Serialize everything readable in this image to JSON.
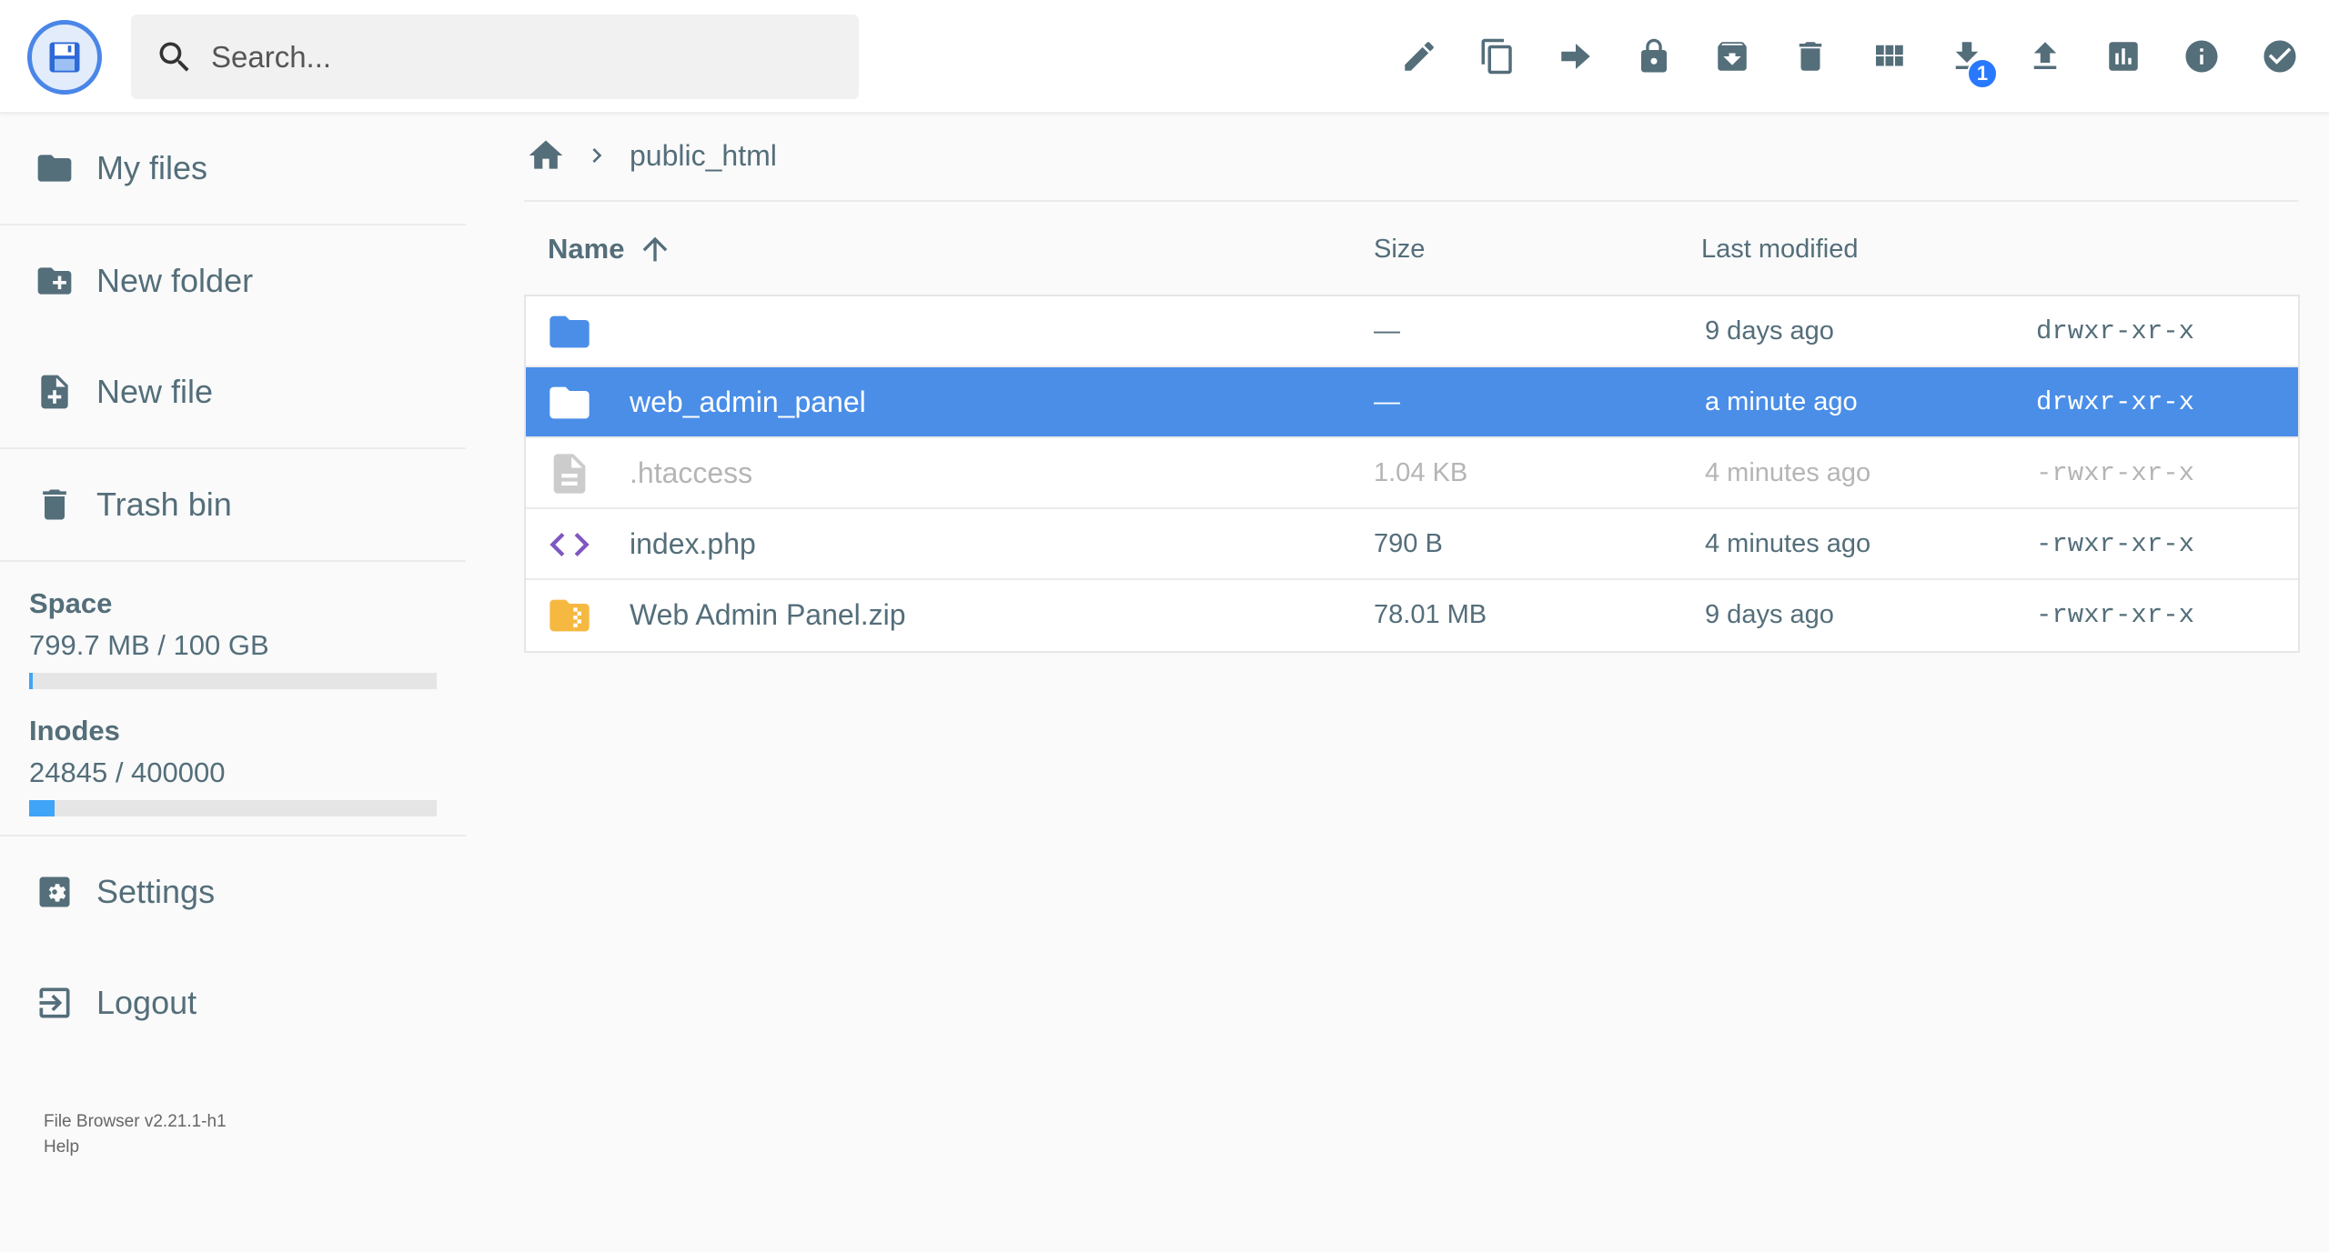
{
  "header": {
    "search_placeholder": "Search...",
    "toolbar": [
      {
        "icon": "edit-icon",
        "label": "Rename"
      },
      {
        "icon": "copy-icon",
        "label": "Copy"
      },
      {
        "icon": "move-icon",
        "label": "Move"
      },
      {
        "icon": "lock-icon",
        "label": "Permissions"
      },
      {
        "icon": "archive-icon",
        "label": "Archive"
      },
      {
        "icon": "delete-icon",
        "label": "Delete"
      },
      {
        "icon": "grid-view-icon",
        "label": "Switch view"
      },
      {
        "icon": "download-icon",
        "label": "Download",
        "badge": "1"
      },
      {
        "icon": "upload-icon",
        "label": "Upload"
      },
      {
        "icon": "chart-icon",
        "label": "Usage"
      },
      {
        "icon": "info-icon",
        "label": "Info"
      },
      {
        "icon": "check-circle-icon",
        "label": "Select multiple"
      }
    ]
  },
  "sidebar": {
    "items": [
      {
        "label": "My files",
        "icon": "folder-icon"
      },
      {
        "label": "New folder",
        "icon": "new-folder-icon"
      },
      {
        "label": "New file",
        "icon": "new-file-icon"
      },
      {
        "label": "Trash bin",
        "icon": "trash-icon"
      }
    ],
    "space": {
      "label": "Space",
      "value": "799.7 MB / 100 GB",
      "fraction": 0.008
    },
    "inodes": {
      "label": "Inodes",
      "value": "24845 / 400000",
      "fraction": 0.062
    },
    "settings": {
      "label": "Settings"
    },
    "logout": {
      "label": "Logout"
    },
    "footer": {
      "version": "File Browser v2.21.1-h1",
      "help": "Help"
    }
  },
  "breadcrumb": {
    "path": "public_html"
  },
  "list": {
    "columns": {
      "name": "Name",
      "size": "Size",
      "modified": "Last modified"
    },
    "rows": [
      {
        "name": "",
        "size": "—",
        "modified": "9 days ago",
        "perms": "drwxr-xr-x",
        "type": "folder"
      },
      {
        "name": "web_admin_panel",
        "size": "—",
        "modified": "a minute ago",
        "perms": "drwxr-xr-x",
        "type": "folder"
      },
      {
        "name": ".htaccess",
        "size": "1.04 KB",
        "modified": "4 minutes ago",
        "perms": "-rwxr-xr-x",
        "type": "file"
      },
      {
        "name": "index.php",
        "size": "790 B",
        "modified": "4 minutes ago",
        "perms": "-rwxr-xr-x",
        "type": "code"
      },
      {
        "name": "Web Admin Panel.zip",
        "size": "78.01 MB",
        "modified": "9 days ago",
        "perms": "-rwxr-xr-x",
        "type": "archive"
      }
    ]
  },
  "colors": {
    "accent": "#4a8ee8",
    "selected_row": "#4a8ee8",
    "quota_bar": "#40a4f7",
    "text": "#546e7a"
  }
}
